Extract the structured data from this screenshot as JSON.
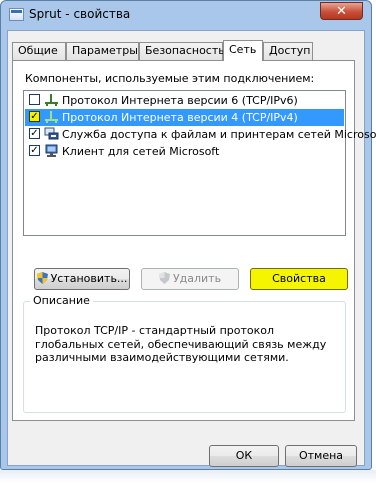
{
  "window": {
    "title": "Sprut - свойства",
    "close_glyph": "✕"
  },
  "tabs": [
    {
      "label": "Общие",
      "active": false
    },
    {
      "label": "Параметры",
      "active": false
    },
    {
      "label": "Безопасность",
      "active": false
    },
    {
      "label": "Сеть",
      "active": true
    },
    {
      "label": "Доступ",
      "active": false
    }
  ],
  "components": {
    "label": "Компоненты, используемые этим подключением:",
    "items": [
      {
        "label": "Протокол Интернета версии 6 (TCP/IPv6)",
        "checked": false,
        "selected": false,
        "icon": "network-protocol-icon"
      },
      {
        "label": "Протокол Интернета версии 4 (TCP/IPv4)",
        "checked": true,
        "selected": true,
        "icon": "network-protocol-icon"
      },
      {
        "label": "Служба доступа к файлам и принтерам сетей Microsoft",
        "checked": true,
        "selected": false,
        "icon": "file-printer-sharing-icon"
      },
      {
        "label": "Клиент для сетей Microsoft",
        "checked": true,
        "selected": false,
        "icon": "network-client-icon"
      }
    ]
  },
  "buttons": {
    "install": "Установить...",
    "remove": "Удалить",
    "properties": "Свойства",
    "ok": "ОК",
    "cancel": "Отмена"
  },
  "description": {
    "legend": "Описание",
    "text": "Протокол TCP/IP - стандартный протокол глобальных сетей, обеспечивающий связь между различными взаимодействующими сетями."
  },
  "colors": {
    "selection": "#3399ff",
    "highlight": "#f5f500",
    "title_bar": "#a9c7ea",
    "close_button": "#c7513a"
  }
}
